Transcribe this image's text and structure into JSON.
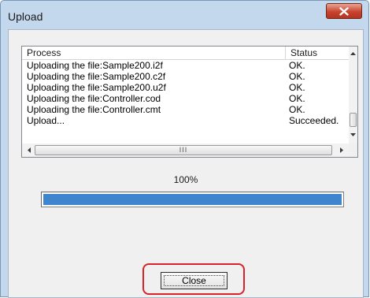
{
  "window": {
    "title": "Upload"
  },
  "list": {
    "headers": {
      "process": "Process",
      "status": "Status"
    },
    "rows": [
      {
        "process": "Uploading the file:Sample200.i2f",
        "status": "OK."
      },
      {
        "process": "Uploading the file:Sample200.c2f",
        "status": "OK."
      },
      {
        "process": "Uploading the file:Sample200.u2f",
        "status": "OK."
      },
      {
        "process": "Uploading the file:Controller.cod",
        "status": "OK."
      },
      {
        "process": "Uploading the file:Controller.cmt",
        "status": "OK."
      },
      {
        "process": "Upload...",
        "status": "Succeeded."
      }
    ],
    "hscroll_grip": "III"
  },
  "progress": {
    "percent_label": "100%",
    "fraction": 1.0,
    "fill_color": "#3f85cd"
  },
  "buttons": {
    "close_label": "Close"
  },
  "colors": {
    "highlight": "#d9232a",
    "titlebar_close": "#c8442f"
  },
  "icons": {
    "titlebar_close": "close-icon",
    "scroll_up": "arrow-up-icon",
    "scroll_down": "arrow-down-icon",
    "scroll_left": "arrow-left-icon",
    "scroll_right": "arrow-right-icon"
  }
}
